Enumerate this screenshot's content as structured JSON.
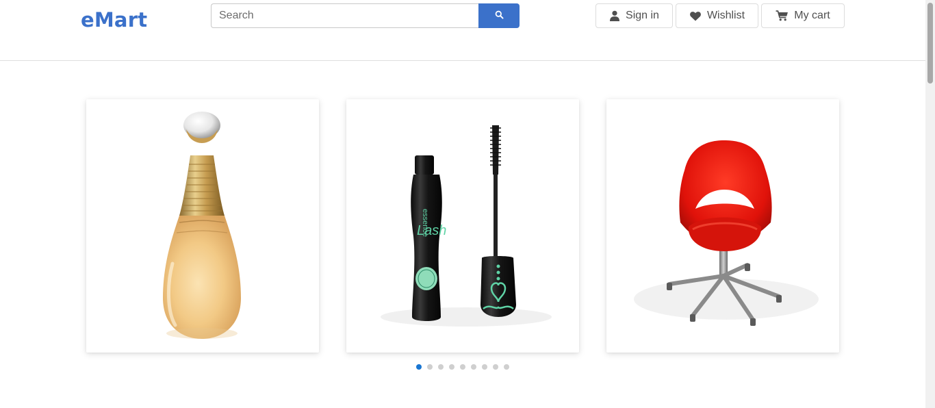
{
  "brand": {
    "name": "eMart",
    "color": "#3b71ca"
  },
  "search": {
    "placeholder": "Search",
    "value": "",
    "button_icon": "search-icon"
  },
  "header_actions": {
    "signin": {
      "label": "Sign in",
      "icon": "user-icon"
    },
    "wishlist": {
      "label": "Wishlist",
      "icon": "heart-icon"
    },
    "cart": {
      "label": "My cart",
      "icon": "cart-icon"
    }
  },
  "carousel": {
    "items": [
      {
        "product": "perfume-bottle"
      },
      {
        "product": "mascara"
      },
      {
        "product": "red-chair"
      }
    ],
    "dots_count": 9,
    "active_dot": 0,
    "active_color": "#1976d2"
  }
}
